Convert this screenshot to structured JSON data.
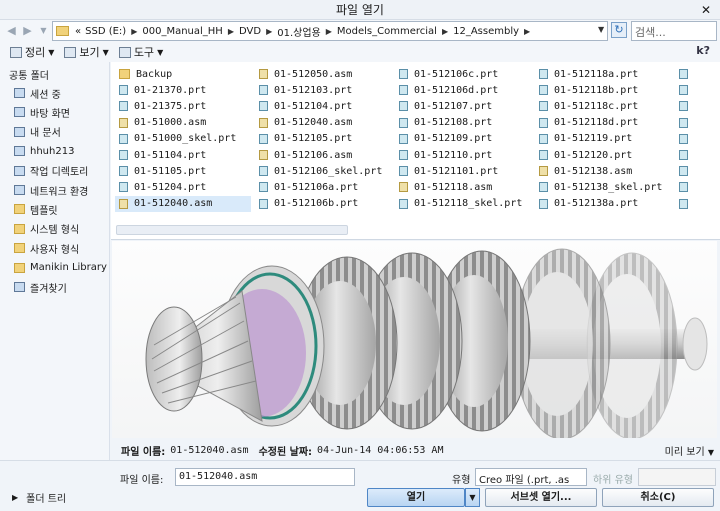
{
  "window": {
    "title": "파일 열기",
    "close": "✕"
  },
  "address": {
    "prefix": "«",
    "crumbs": [
      "SSD (E:)",
      "000_Manual_HH",
      "DVD",
      "01.상업용",
      "Models_Commercial",
      "12_Assembly"
    ],
    "search_placeholder": "검색..."
  },
  "toolbar": {
    "organize": "정리",
    "view": "보기",
    "tools": "도구",
    "help": "k?"
  },
  "sidebar": {
    "header": "공통 폴더",
    "items": [
      {
        "label": "세션 중",
        "icon": "session-icon"
      },
      {
        "label": "바탕 화면",
        "icon": "desktop-icon"
      },
      {
        "label": "내 문서",
        "icon": "documents-folder-icon"
      },
      {
        "label": "hhuh213",
        "icon": "computer-icon"
      },
      {
        "label": "작업 디렉토리",
        "icon": "working-directory-icon"
      },
      {
        "label": "네트워크 환경",
        "icon": "network-icon"
      },
      {
        "label": "템플릿",
        "icon": "folder-icon"
      },
      {
        "label": "시스템 형식",
        "icon": "folder-icon"
      },
      {
        "label": "사용자 형식",
        "icon": "folder-icon"
      },
      {
        "label": "Manikin Library",
        "icon": "folder-icon"
      },
      {
        "label": "즐겨찾기",
        "icon": "favorites-icon"
      }
    ],
    "folder_tree": "폴더 트리"
  },
  "files": [
    [
      {
        "name": "Backup",
        "type": "folder"
      },
      {
        "name": "01-21370.prt",
        "type": "prt"
      },
      {
        "name": "01-21375.prt",
        "type": "prt"
      },
      {
        "name": "01-51000.asm",
        "type": "asm"
      },
      {
        "name": "01-51000_skel.prt",
        "type": "prt"
      },
      {
        "name": "01-51104.prt",
        "type": "prt"
      },
      {
        "name": "01-51105.prt",
        "type": "prt"
      },
      {
        "name": "01-51204.prt",
        "type": "prt"
      },
      {
        "name": "01-512040.asm",
        "type": "asm",
        "selected": true
      }
    ],
    [
      {
        "name": "01-512050.asm",
        "type": "asm"
      },
      {
        "name": "01-512103.prt",
        "type": "prt"
      },
      {
        "name": "01-512104.prt",
        "type": "prt"
      },
      {
        "name": "01-512040.asm",
        "type": "asm"
      },
      {
        "name": "01-512105.prt",
        "type": "prt"
      },
      {
        "name": "01-512106.asm",
        "type": "asm"
      },
      {
        "name": "01-512106_skel.prt",
        "type": "prt"
      },
      {
        "name": "01-512106a.prt",
        "type": "prt"
      },
      {
        "name": "01-512106b.prt",
        "type": "prt"
      }
    ],
    [
      {
        "name": "01-512106c.prt",
        "type": "prt"
      },
      {
        "name": "01-512106d.prt",
        "type": "prt"
      },
      {
        "name": "01-512107.prt",
        "type": "prt"
      },
      {
        "name": "01-512108.prt",
        "type": "prt"
      },
      {
        "name": "01-512109.prt",
        "type": "prt"
      },
      {
        "name": "01-512110.prt",
        "type": "prt"
      },
      {
        "name": "01-5121101.prt",
        "type": "prt"
      },
      {
        "name": "01-512118.asm",
        "type": "asm"
      },
      {
        "name": "01-512118_skel.prt",
        "type": "prt"
      }
    ],
    [
      {
        "name": "01-512118a.prt",
        "type": "prt"
      },
      {
        "name": "01-512118b.prt",
        "type": "prt"
      },
      {
        "name": "01-512118c.prt",
        "type": "prt"
      },
      {
        "name": "01-512118d.prt",
        "type": "prt"
      },
      {
        "name": "01-512119.prt",
        "type": "prt"
      },
      {
        "name": "01-512120.prt",
        "type": "prt"
      },
      {
        "name": "01-512138.asm",
        "type": "asm"
      },
      {
        "name": "01-512138_skel.prt",
        "type": "prt"
      },
      {
        "name": "01-512138a.prt",
        "type": "prt"
      }
    ]
  ],
  "info": {
    "name_label": "파일 이름:",
    "name_value": "01-512040.asm",
    "modified_label": "수정된 날짜:",
    "modified_value": "04-Jun-14 04:06:53 AM",
    "preview_toggle": "미리 보기"
  },
  "bottom": {
    "filename_label": "파일 이름:",
    "filename_value": "01-512040.asm",
    "type_label": "유형",
    "type_value": "Creo 파일 (.prt, .as",
    "subtype_label": "하위 유형",
    "open": "열기",
    "open_subset": "서브셋 열기...",
    "cancel": "취소(C)"
  }
}
